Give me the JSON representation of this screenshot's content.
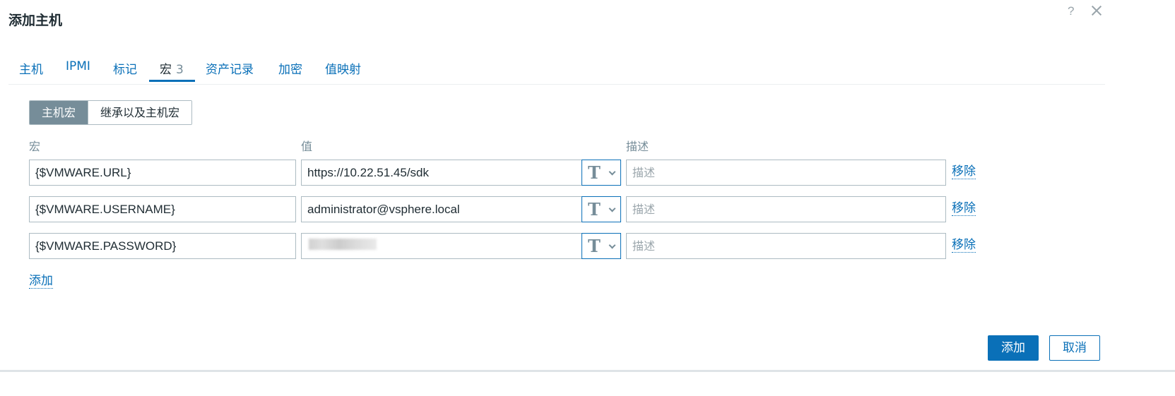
{
  "dialog": {
    "title": "添加主机",
    "help_symbol": "?"
  },
  "tabs": [
    {
      "label": "主机",
      "active": false
    },
    {
      "label": "IPMI",
      "active": false
    },
    {
      "label": "标记",
      "active": false
    },
    {
      "label": "宏",
      "count": "3",
      "active": true
    },
    {
      "label": "资产记录",
      "active": false
    },
    {
      "label": "加密",
      "active": false
    },
    {
      "label": "值映射",
      "active": false
    }
  ],
  "macro_mode": {
    "host_macros": "主机宏",
    "inherited_and_host_macros": "继承以及主机宏",
    "selected": "host_macros"
  },
  "columns": {
    "macro": "宏",
    "value": "值",
    "description": "描述"
  },
  "macros": [
    {
      "macro": "{$VMWARE.URL}",
      "value": "https://10.22.51.45/sdk",
      "description_placeholder": "描述",
      "value_type": "text",
      "remove": "移除"
    },
    {
      "macro": "{$VMWARE.USERNAME}",
      "value": "administrator@vsphere.local",
      "description_placeholder": "描述",
      "value_type": "text",
      "remove": "移除"
    },
    {
      "macro": "{$VMWARE.PASSWORD}",
      "value": "",
      "description_placeholder": "描述",
      "value_type": "text",
      "remove": "移除"
    }
  ],
  "add_link": "添加",
  "footer": {
    "add_button": "添加",
    "cancel_button": "取消"
  },
  "colors": {
    "accent": "#0a70b8",
    "active_segment": "#768d99",
    "border": "#acbbc2"
  }
}
